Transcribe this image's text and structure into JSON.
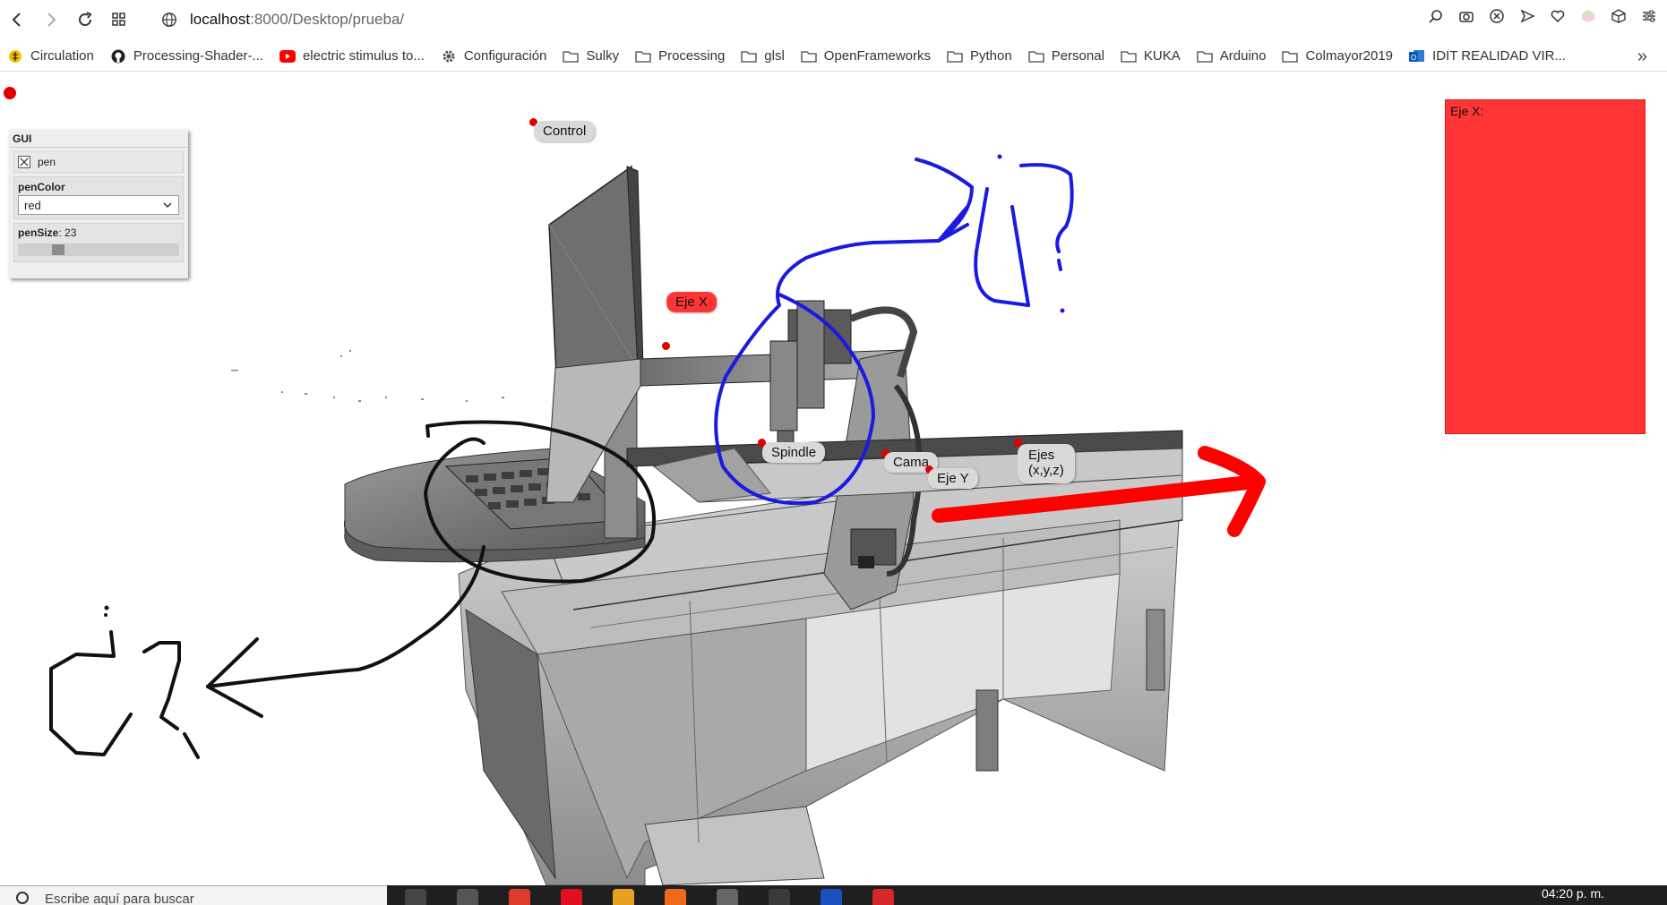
{
  "browser": {
    "url_host": "localhost",
    "url_path": ":8000/Desktop/prueba/",
    "bookmarks": [
      {
        "label": "Circulation",
        "icon": "circulation-icon"
      },
      {
        "label": "Processing-Shader-...",
        "icon": "github-icon"
      },
      {
        "label": "electric stimulus to...",
        "icon": "youtube-icon"
      },
      {
        "label": "Configuración",
        "icon": "gear-icon"
      },
      {
        "label": "Sulky",
        "icon": "folder-icon"
      },
      {
        "label": "Processing",
        "icon": "folder-icon"
      },
      {
        "label": "glsl",
        "icon": "folder-icon"
      },
      {
        "label": "OpenFrameworks",
        "icon": "folder-icon"
      },
      {
        "label": "Python",
        "icon": "folder-icon"
      },
      {
        "label": "Personal",
        "icon": "folder-icon"
      },
      {
        "label": "KUKA",
        "icon": "folder-icon"
      },
      {
        "label": "Arduino",
        "icon": "folder-icon"
      },
      {
        "label": "Colmayor2019",
        "icon": "folder-icon"
      },
      {
        "label": "IDIT REALIDAD VIR...",
        "icon": "outlook-icon"
      }
    ]
  },
  "gui": {
    "title": "GUI",
    "pen_label": "pen",
    "pen_checked": true,
    "pen_color_label": "penColor",
    "pen_color_value": "red",
    "pen_size_label": "penSize",
    "pen_size_value": "23",
    "pen_size_fraction": 0.23
  },
  "labels": {
    "control": "Control",
    "eje_x": "Eje X",
    "spindle": "Spindle",
    "cama": "Cama",
    "ejes_line1": "Ejes",
    "ejes_line2": "(x,y,z)",
    "eje_y": "Eje Y"
  },
  "info_panel": {
    "title": "Eje X:",
    "color": "#ff3535"
  },
  "annotations": {
    "question_marks": "¿?"
  },
  "taskbar": {
    "search_placeholder": "Escribe aquí para buscar",
    "clock": "04:20 p. m."
  }
}
